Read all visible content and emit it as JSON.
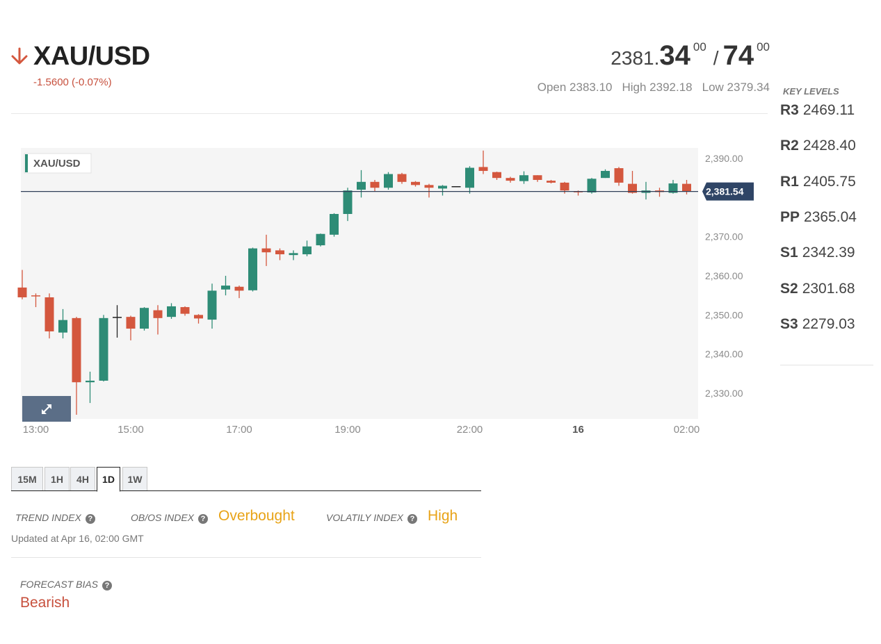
{
  "header": {
    "symbol": "XAU/USD",
    "change": "-1.5600 (-0.07%)",
    "bid_small": "2381.",
    "bid_big": "34",
    "bid_sup": "00",
    "separator": "/",
    "ask_big": "74",
    "ask_sup": "00",
    "open": "Open 2383.10",
    "high": "High 2392.18",
    "low": "Low 2379.34",
    "trend_icon": "arrow-down-icon",
    "trend_color": "#d4573e"
  },
  "key_levels": {
    "title": "KEY LEVELS",
    "levels": [
      {
        "label": "R3",
        "value": "2469.11"
      },
      {
        "label": "R2",
        "value": "2428.40"
      },
      {
        "label": "R1",
        "value": "2405.75"
      },
      {
        "label": "PP",
        "value": "2365.04"
      },
      {
        "label": "S1",
        "value": "2342.39"
      },
      {
        "label": "S2",
        "value": "2301.68"
      },
      {
        "label": "S3",
        "value": "2279.03"
      }
    ]
  },
  "chart_data": {
    "type": "candlestick",
    "legend": "XAU/USD",
    "current_price": 2381.54,
    "current_price_label": "2,381.54",
    "ylim": [
      2323,
      2392
    ],
    "y_ticks": [
      2330,
      2340,
      2350,
      2360,
      2370,
      2390
    ],
    "y_tick_labels": [
      "2,330.00",
      "2,340.00",
      "2,350.00",
      "2,360.00",
      "2,370.00",
      "2,390.00"
    ],
    "x_ticks": [
      {
        "index": 1,
        "label": "13:00",
        "bold": false
      },
      {
        "index": 8,
        "label": "15:00",
        "bold": false
      },
      {
        "index": 16,
        "label": "17:00",
        "bold": false
      },
      {
        "index": 24,
        "label": "19:00",
        "bold": false
      },
      {
        "index": 33,
        "label": "22:00",
        "bold": false
      },
      {
        "index": 41,
        "label": "16",
        "bold": true
      },
      {
        "index": 49,
        "label": "02:00",
        "bold": false
      }
    ],
    "colors": {
      "up": "#2e8c76",
      "down": "#d4573e",
      "doji": "#222222",
      "price_line": "#2f3e58",
      "price_tag": "#2f4566"
    },
    "candles": [
      {
        "o": 2357,
        "h": 2361.5,
        "l": 2354,
        "c": 2354.5
      },
      {
        "o": 2355,
        "h": 2355.5,
        "l": 2352,
        "c": 2354.8
      },
      {
        "o": 2354.5,
        "h": 2355.5,
        "l": 2344,
        "c": 2345.8
      },
      {
        "o": 2345.5,
        "h": 2351.5,
        "l": 2344,
        "c": 2348.7
      },
      {
        "o": 2349.2,
        "h": 2349.5,
        "l": 2324.5,
        "c": 2332.8
      },
      {
        "o": 2332.8,
        "h": 2335.5,
        "l": 2327.5,
        "c": 2333.2
      },
      {
        "o": 2333.2,
        "h": 2350,
        "l": 2333,
        "c": 2349.2
      },
      {
        "o": 2349.5,
        "h": 2352.5,
        "l": 2344.2,
        "c": 2349.5
      },
      {
        "o": 2349.5,
        "h": 2349.8,
        "l": 2343.5,
        "c": 2346.5
      },
      {
        "o": 2346.5,
        "h": 2352,
        "l": 2346,
        "c": 2351.8
      },
      {
        "o": 2351.2,
        "h": 2352.5,
        "l": 2345,
        "c": 2349.2
      },
      {
        "o": 2349.5,
        "h": 2353,
        "l": 2349,
        "c": 2352.2
      },
      {
        "o": 2352,
        "h": 2352.2,
        "l": 2349.8,
        "c": 2350.3
      },
      {
        "o": 2350,
        "h": 2350.2,
        "l": 2347.8,
        "c": 2349.1
      },
      {
        "o": 2348.8,
        "h": 2358,
        "l": 2346.5,
        "c": 2356.2
      },
      {
        "o": 2356.5,
        "h": 2360,
        "l": 2355,
        "c": 2357.5
      },
      {
        "o": 2357.2,
        "h": 2357.5,
        "l": 2354.3,
        "c": 2356.2
      },
      {
        "o": 2356.3,
        "h": 2367.2,
        "l": 2356,
        "c": 2367
      },
      {
        "o": 2367,
        "h": 2370.5,
        "l": 2362.5,
        "c": 2366
      },
      {
        "o": 2366.5,
        "h": 2367,
        "l": 2364,
        "c": 2365.5
      },
      {
        "o": 2365.3,
        "h": 2366.5,
        "l": 2364,
        "c": 2365.8
      },
      {
        "o": 2365.5,
        "h": 2369,
        "l": 2365,
        "c": 2367.5
      },
      {
        "o": 2367.8,
        "h": 2370.8,
        "l": 2367.5,
        "c": 2370.7
      },
      {
        "o": 2370.5,
        "h": 2376,
        "l": 2370,
        "c": 2375.8
      },
      {
        "o": 2375.8,
        "h": 2382.5,
        "l": 2374,
        "c": 2381.8
      },
      {
        "o": 2382,
        "h": 2387,
        "l": 2380,
        "c": 2384
      },
      {
        "o": 2384,
        "h": 2384.5,
        "l": 2381.5,
        "c": 2382.5
      },
      {
        "o": 2382.5,
        "h": 2386.5,
        "l": 2382,
        "c": 2386
      },
      {
        "o": 2386,
        "h": 2386.3,
        "l": 2383.5,
        "c": 2384
      },
      {
        "o": 2384,
        "h": 2384.2,
        "l": 2382.8,
        "c": 2383.2
      },
      {
        "o": 2383.2,
        "h": 2383.5,
        "l": 2380,
        "c": 2382.5
      },
      {
        "o": 2382.3,
        "h": 2383.2,
        "l": 2380.5,
        "c": 2383
      },
      {
        "o": 2382.9,
        "h": 2382.9,
        "l": 2382.9,
        "c": 2382.9
      },
      {
        "o": 2382.5,
        "h": 2388,
        "l": 2381,
        "c": 2387.6
      },
      {
        "o": 2387.8,
        "h": 2392,
        "l": 2386,
        "c": 2386.8
      },
      {
        "o": 2386.5,
        "h": 2386.6,
        "l": 2384.5,
        "c": 2385
      },
      {
        "o": 2385,
        "h": 2385.3,
        "l": 2383.8,
        "c": 2384.3
      },
      {
        "o": 2384.2,
        "h": 2386.7,
        "l": 2383.5,
        "c": 2385.7
      },
      {
        "o": 2385.7,
        "h": 2385.7,
        "l": 2384,
        "c": 2384.5
      },
      {
        "o": 2384.3,
        "h": 2384.5,
        "l": 2383.6,
        "c": 2383.8
      },
      {
        "o": 2383.8,
        "h": 2384,
        "l": 2381,
        "c": 2381.8
      },
      {
        "o": 2381.6,
        "h": 2381.8,
        "l": 2380.5,
        "c": 2381.4
      },
      {
        "o": 2381.3,
        "h": 2385,
        "l": 2381,
        "c": 2384.8
      },
      {
        "o": 2385,
        "h": 2387.2,
        "l": 2385,
        "c": 2386.8
      },
      {
        "o": 2387.5,
        "h": 2387.8,
        "l": 2383,
        "c": 2383.8
      },
      {
        "o": 2383.5,
        "h": 2386.8,
        "l": 2381,
        "c": 2381.2
      },
      {
        "o": 2381.2,
        "h": 2384,
        "l": 2379.5,
        "c": 2381.8
      },
      {
        "o": 2381.8,
        "h": 2382.5,
        "l": 2380.2,
        "c": 2381.4
      },
      {
        "o": 2381.2,
        "h": 2384.5,
        "l": 2381,
        "c": 2383.6
      },
      {
        "o": 2383.5,
        "h": 2384.5,
        "l": 2380.8,
        "c": 2381.5
      }
    ]
  },
  "expand_icon": "expand-icon",
  "timeframes": {
    "tabs": [
      "15M",
      "1H",
      "4H",
      "1D",
      "1W"
    ],
    "active": "1D"
  },
  "indices": {
    "trend_label": "TREND INDEX",
    "obos_label": "OB/OS INDEX",
    "obos_value": "Overbought",
    "volatility_label": "VOLATILY INDEX",
    "volatility_value": "High",
    "help_icon": "help-icon",
    "value_color": "#e8a317",
    "updated": "Updated at Apr 16, 02:00 GMT"
  },
  "forecast": {
    "label": "FORECAST BIAS",
    "value": "Bearish",
    "value_color": "#c7503d"
  }
}
